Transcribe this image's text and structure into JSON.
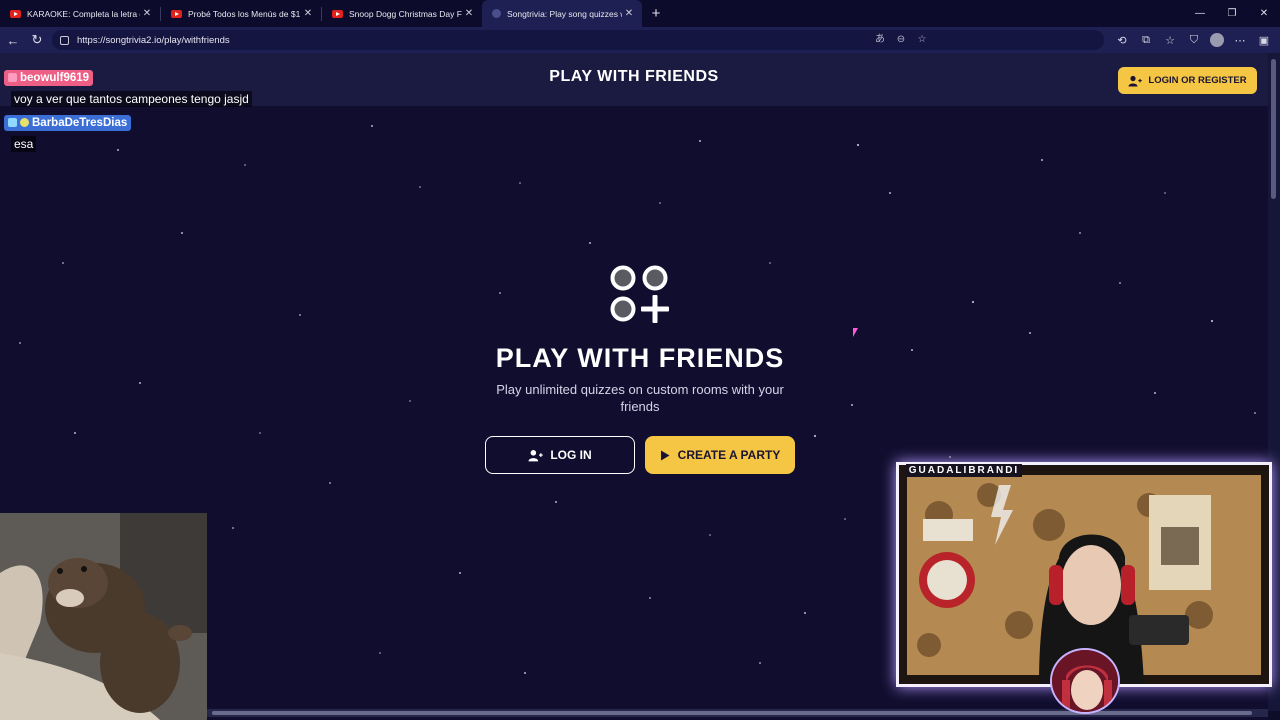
{
  "browser": {
    "tabs": [
      {
        "title": "KARAOKE: Completa la letra de la",
        "icon": "youtube-icon",
        "active": false
      },
      {
        "title": "Probé Todos los Menús de $1 de C",
        "icon": "youtube-icon",
        "active": false
      },
      {
        "title": "Snoop Dogg Christmas Day FULL",
        "icon": "youtube-icon",
        "active": false
      },
      {
        "title": "Songtrivia: Play song quizzes with",
        "icon": "songtrivia-icon",
        "active": true
      }
    ],
    "url": "https://songtrivia2.io/play/withfriends"
  },
  "site": {
    "header_title": "PLAY WITH FRIENDS",
    "login_register_label": "LOGIN OR REGISTER"
  },
  "hero": {
    "title": "PLAY WITH FRIENDS",
    "subtitle": "Play unlimited quizzes on custom rooms with your friends",
    "login_label": "LOG IN",
    "create_party_label": "CREATE A PARTY"
  },
  "stream": {
    "chat": [
      {
        "user": "beowulf9619",
        "message": "voy a ver que tantos campeones tengo jasjd",
        "color": "#ee5f86"
      },
      {
        "user": "BarbaDeTresDias",
        "message": "esa",
        "color": "#3b6fd6"
      }
    ],
    "webcam_name": "GUADALIBRANDI"
  },
  "colors": {
    "accent": "#f5c644",
    "background": "#100d2e",
    "header": "#1b1a40"
  }
}
